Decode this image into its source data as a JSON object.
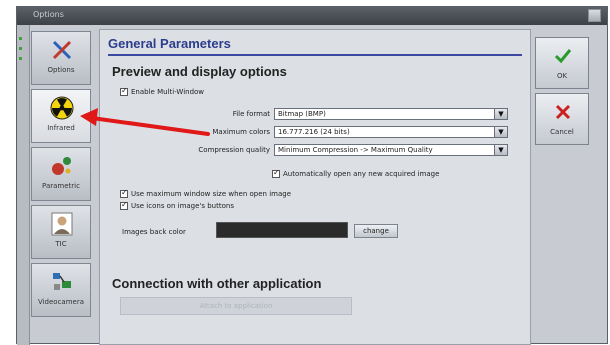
{
  "window": {
    "title": "Options"
  },
  "sidebar": {
    "items": [
      {
        "label": "Options"
      },
      {
        "label": "Infrared"
      },
      {
        "label": "Parametric"
      },
      {
        "label": "TIC"
      },
      {
        "label": "Videocamera"
      }
    ]
  },
  "panel": {
    "title": "General Parameters",
    "preview_heading": "Preview and display options",
    "enable_multi_window": "Enable Multi-Window",
    "file_format_label": "File format",
    "file_format_value": "Bitmap (BMP)",
    "max_colors_label": "Maximum colors",
    "max_colors_value": "16.777.216 (24 bits)",
    "compression_label": "Compression quality",
    "compression_value": "Minimum Compression -> Maximum Quality",
    "auto_open": "Automatically open any new acquired image",
    "use_max_window": "Use maximum window size when open image",
    "use_icons": "Use icons on image's buttons",
    "back_color_label": "Images back color",
    "change_button": "change",
    "connection_heading": "Connection with other application",
    "connection_button": "Attach to application"
  },
  "actions": {
    "ok_label": "OK",
    "cancel_label": "Cancel"
  },
  "colors": {
    "section_title": "#2c3e8c",
    "ok_check": "#2a9a2a",
    "cancel_x": "#cc1f1f",
    "arrow": "#e01818"
  }
}
